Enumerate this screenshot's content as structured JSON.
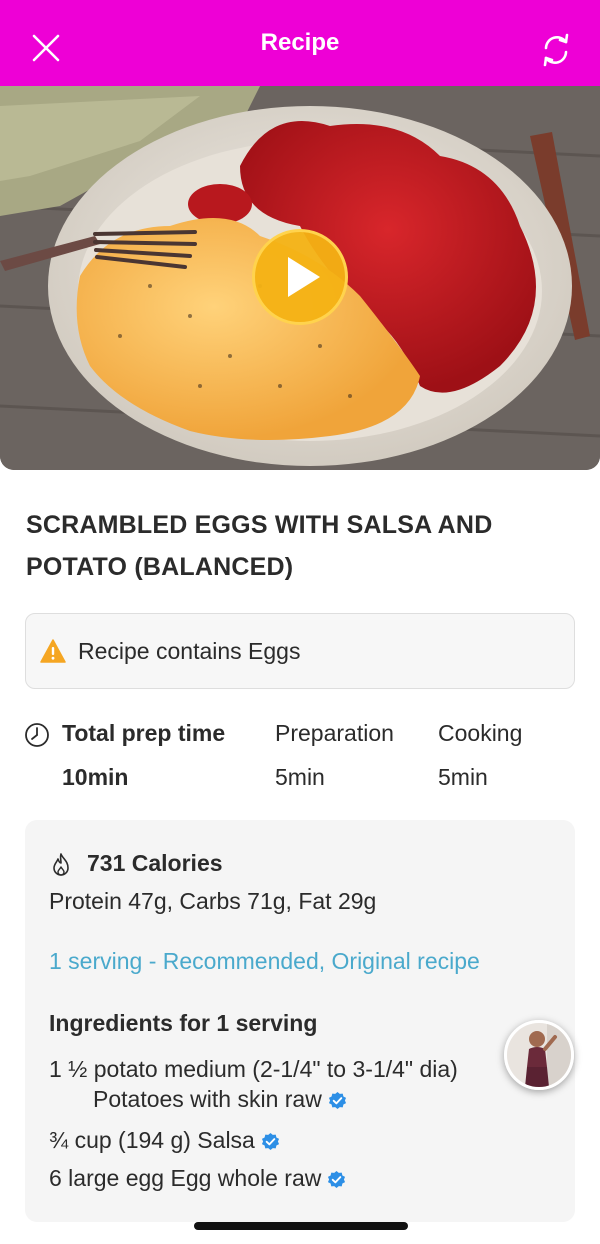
{
  "header": {
    "title": "Recipe",
    "close_icon": "close-icon",
    "swap_icon": "swap-recipe-icon",
    "background": "#ee00d6"
  },
  "hero": {
    "play_icon": "play-icon",
    "play_color": "#f4b214"
  },
  "recipe": {
    "title": "SCRAMBLED EGGS WITH SALSA AND POTATO (BALANCED)"
  },
  "allergen": {
    "icon": "warning-icon",
    "text": "Recipe contains Eggs"
  },
  "times": {
    "clock_icon": "clock-icon",
    "total_label": "Total prep time",
    "total_value": "10min",
    "prep_label": "Preparation",
    "prep_value": "5min",
    "cook_label": "Cooking",
    "cook_value": "5min"
  },
  "nutrition": {
    "flame_icon": "flame-icon",
    "calories": "731 Calories",
    "macros": "Protein 47g, Carbs 71g, Fat 29g",
    "serving_link": "1 serving - Recommended, Original recipe",
    "link_color": "#4aa9cc",
    "ingredients_heading": "Ingredients for 1 serving",
    "ingredients": [
      {
        "line1": "1 ½ potato medium (2-1/4\" to 3-1/4\" dia)",
        "line2": "Potatoes with skin raw"
      },
      {
        "line1": "¾ cup (194 g) Salsa"
      },
      {
        "line1": "6 large egg Egg whole raw"
      }
    ],
    "verified_icon": "verified-badge-icon",
    "verified_color": "#2d8fe6"
  },
  "floating": {
    "avatar_icon": "coach-avatar"
  }
}
